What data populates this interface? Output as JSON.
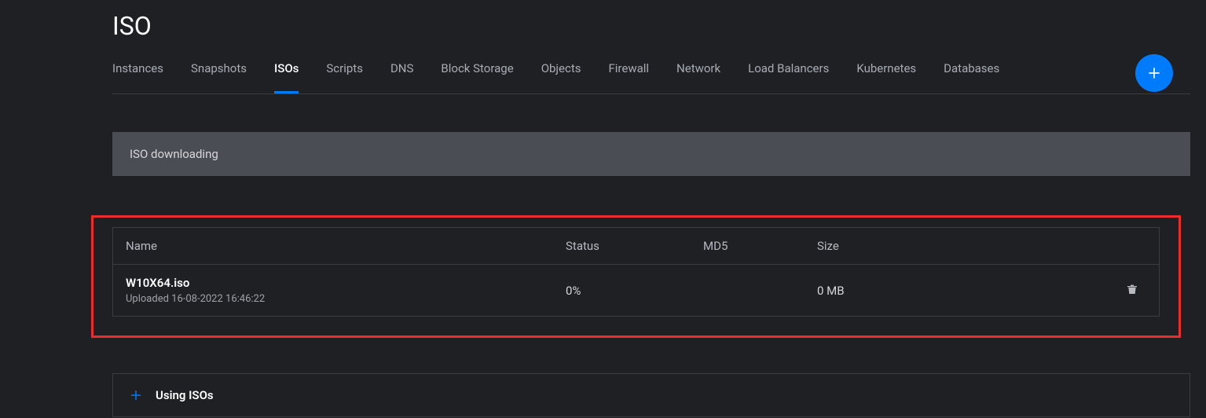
{
  "page": {
    "title": "ISO"
  },
  "nav": {
    "tabs": [
      {
        "label": "Instances",
        "active": false
      },
      {
        "label": "Snapshots",
        "active": false
      },
      {
        "label": "ISOs",
        "active": true
      },
      {
        "label": "Scripts",
        "active": false
      },
      {
        "label": "DNS",
        "active": false
      },
      {
        "label": "Block Storage",
        "active": false
      },
      {
        "label": "Objects",
        "active": false
      },
      {
        "label": "Firewall",
        "active": false
      },
      {
        "label": "Network",
        "active": false
      },
      {
        "label": "Load Balancers",
        "active": false
      },
      {
        "label": "Kubernetes",
        "active": false
      },
      {
        "label": "Databases",
        "active": false
      }
    ]
  },
  "notice": {
    "text": "ISO downloading"
  },
  "table": {
    "headers": {
      "name": "Name",
      "status": "Status",
      "md5": "MD5",
      "size": "Size"
    },
    "rows": [
      {
        "name": "W10X64.iso",
        "meta": "Uploaded 16-08-2022 16:46:22",
        "status": "0%",
        "md5": "",
        "size": "0 MB"
      }
    ]
  },
  "panel": {
    "using_label": "Using ISOs"
  }
}
